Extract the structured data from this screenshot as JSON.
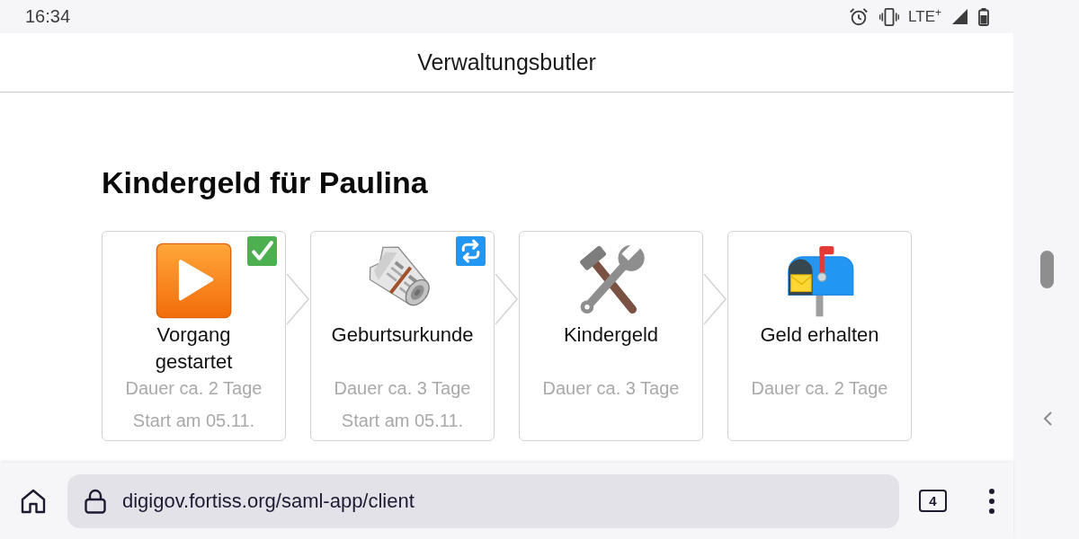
{
  "status_bar": {
    "time": "16:34",
    "network": "LTE$^{+}$"
  },
  "header": {
    "title": "Verwaltungsbutler"
  },
  "page": {
    "title": "Kindergeld für Paulina",
    "steps": [
      {
        "kind": "play",
        "label": "Vorgang gestartet",
        "duration": "Dauer ca. 2 Tage",
        "start": "Start am 05.11.",
        "completed": true,
        "in_progress": false
      },
      {
        "kind": "newspaper",
        "label": "Geburtsurkunde",
        "duration": "Dauer ca. 3 Tage",
        "start": "Start am 05.11.",
        "completed": false,
        "in_progress": true
      },
      {
        "kind": "tools",
        "label": "Kindergeld",
        "duration": "Dauer ca. 3 Tage",
        "completed": false,
        "in_progress": false
      },
      {
        "kind": "mailbox",
        "label": "Geld erhalten",
        "duration": "Dauer ca. 2 Tage",
        "completed": false,
        "in_progress": false
      }
    ]
  },
  "browser_bar": {
    "url": "digigov.fortiss.org/saml-app/client",
    "tab_count": "4"
  }
}
